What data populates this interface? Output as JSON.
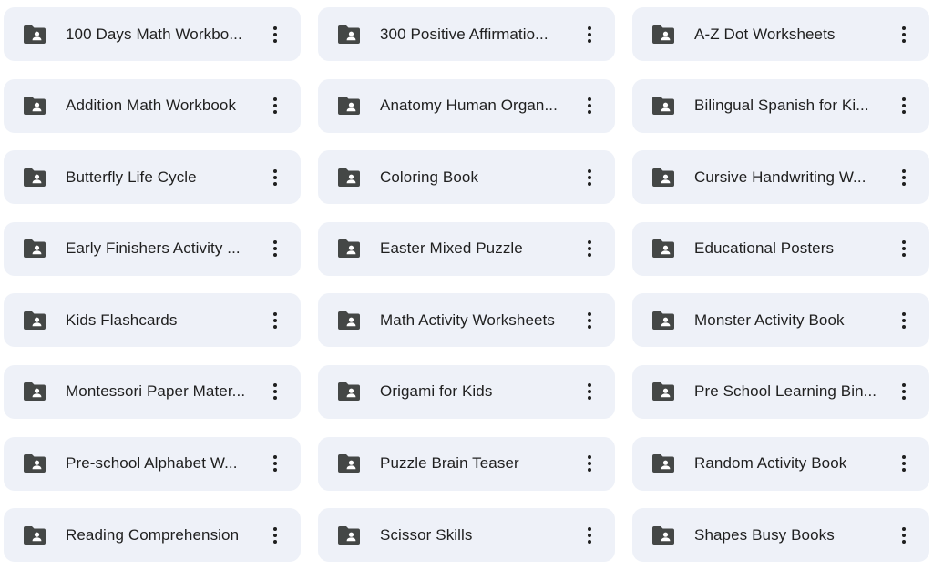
{
  "colors": {
    "card_background": "#eef1f8",
    "text": "#1f1f1f",
    "icon": "#444746"
  },
  "folders": [
    {
      "name": "100 Days Math Workbo...",
      "icon": "shared-folder-icon"
    },
    {
      "name": "300 Positive Affirmatio...",
      "icon": "shared-folder-icon"
    },
    {
      "name": "A-Z Dot Worksheets",
      "icon": "shared-folder-icon"
    },
    {
      "name": "Addition Math Workbook",
      "icon": "shared-folder-icon"
    },
    {
      "name": "Anatomy Human Organ...",
      "icon": "shared-folder-icon"
    },
    {
      "name": "Bilingual Spanish for Ki...",
      "icon": "shared-folder-icon"
    },
    {
      "name": "Butterfly Life Cycle",
      "icon": "shared-folder-icon"
    },
    {
      "name": "Coloring Book",
      "icon": "shared-folder-icon"
    },
    {
      "name": "Cursive Handwriting W...",
      "icon": "shared-folder-icon"
    },
    {
      "name": "Early Finishers Activity ...",
      "icon": "shared-folder-icon"
    },
    {
      "name": "Easter Mixed Puzzle",
      "icon": "shared-folder-icon"
    },
    {
      "name": "Educational Posters",
      "icon": "shared-folder-icon"
    },
    {
      "name": "Kids Flashcards",
      "icon": "shared-folder-icon"
    },
    {
      "name": "Math Activity Worksheets",
      "icon": "shared-folder-icon"
    },
    {
      "name": "Monster Activity Book",
      "icon": "shared-folder-icon"
    },
    {
      "name": "Montessori Paper Mater...",
      "icon": "shared-folder-icon"
    },
    {
      "name": "Origami for Kids",
      "icon": "shared-folder-icon"
    },
    {
      "name": "Pre School Learning Bin...",
      "icon": "shared-folder-icon"
    },
    {
      "name": "Pre-school Alphabet W...",
      "icon": "shared-folder-icon"
    },
    {
      "name": "Puzzle Brain Teaser",
      "icon": "shared-folder-icon"
    },
    {
      "name": "Random Activity Book",
      "icon": "shared-folder-icon"
    },
    {
      "name": "Reading Comprehension",
      "icon": "shared-folder-icon"
    },
    {
      "name": "Scissor Skills",
      "icon": "shared-folder-icon"
    },
    {
      "name": "Shapes Busy Books",
      "icon": "shared-folder-icon"
    }
  ],
  "more_actions_icon": "more-vert-icon"
}
